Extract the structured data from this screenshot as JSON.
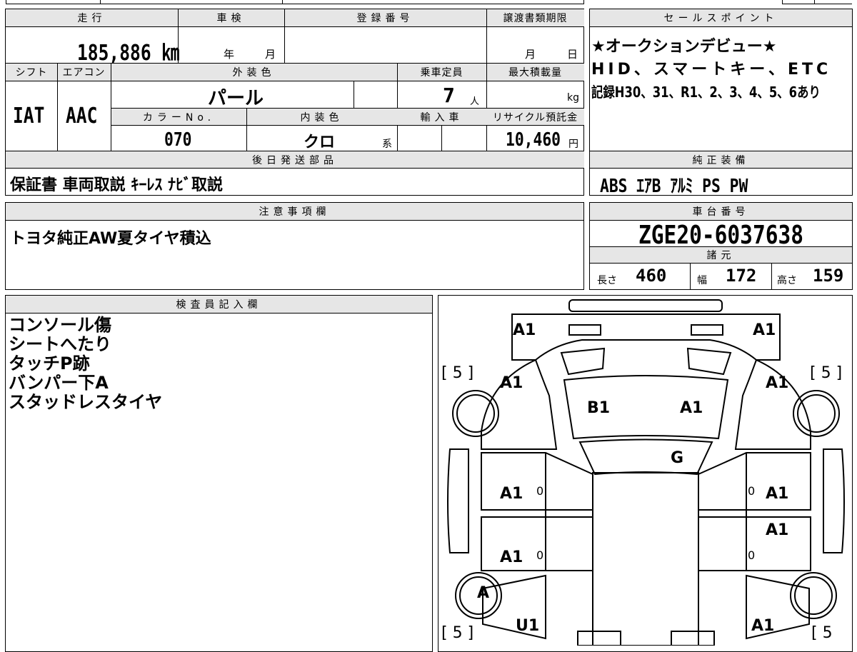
{
  "top": {
    "mileage_header": "走行",
    "inspection_header": "車検",
    "registration_header": "登録番号",
    "transfer_header": "譲渡書類期限",
    "mileage_value": "185,886 ㎞",
    "inspection_year": "年",
    "inspection_month": "月",
    "transfer_month": "月",
    "transfer_day": "日"
  },
  "mid": {
    "shift_header": "シフト",
    "aircon_header": "エアコン",
    "exterior_header": "外装色",
    "capacity_header": "乗車定員",
    "max_load_header": "最大積載量",
    "shift_value": "IAT",
    "aircon_value": "AAC",
    "exterior_value": "パール",
    "capacity_value": "7",
    "capacity_unit": "人",
    "load_unit": "kg",
    "color_no_header": "カラーNo.",
    "interior_header": "内装色",
    "import_header": "輸入車",
    "recycle_header": "リサイクル預託金",
    "color_no_value": "070",
    "interior_value": "クロ",
    "interior_suffix": "系",
    "recycle_value": "10,460",
    "recycle_unit": "円"
  },
  "sales": {
    "header": "セールスポイント",
    "line1": "★オークションデビュー★",
    "line2": "HID、スマートキー、ETC",
    "line3": "記録H30、31、R1、2、3、4、5、6あり"
  },
  "parts": {
    "header": "後日発送部品",
    "value": "保証書 車両取説 ｷｰﾚｽ ﾅﾋﾞ取説"
  },
  "equipment": {
    "header": "純正装備",
    "value": "ABS ｴｱB ｱﾙﾐ PS PW"
  },
  "notes": {
    "header": "注意事項欄",
    "value": "トヨタ純正AW夏タイヤ積込"
  },
  "chassis": {
    "header": "車台番号",
    "value": "ZGE20-6037638"
  },
  "specs": {
    "header": "諸元",
    "length_label": "長さ",
    "length_value": "460",
    "width_label": "幅",
    "width_value": "172",
    "height_label": "高さ",
    "height_value": "159"
  },
  "inspector": {
    "header": "検査員記入欄",
    "lines": [
      "コンソール傷",
      "シートへたり",
      "タッチP跡",
      "バンパー下A",
      "スタッドレスタイヤ"
    ]
  },
  "diagram": {
    "front_left_corner": "A1",
    "front_right_corner": "A1",
    "tire_fl": "[ 5 ]",
    "tire_fr": "[ 5 ]",
    "tire_rl": "[ 5 ]",
    "tire_rr": "[ 5",
    "fender_left": "A1",
    "fender_right": "A1",
    "hood_left": "B1",
    "hood_right": "A1",
    "windshield": "G",
    "front_door_left": "A1",
    "front_door_right": "A1",
    "rear_door_right_upper": "A1",
    "rear_door_left": "A1",
    "pillar_fl": "0",
    "pillar_fr": "0",
    "pillar_rl": "0",
    "pillar_rr": "0",
    "rear_wheel_left": "A",
    "rear_quarter_left": "U1",
    "rear_quarter_right": "A1"
  }
}
